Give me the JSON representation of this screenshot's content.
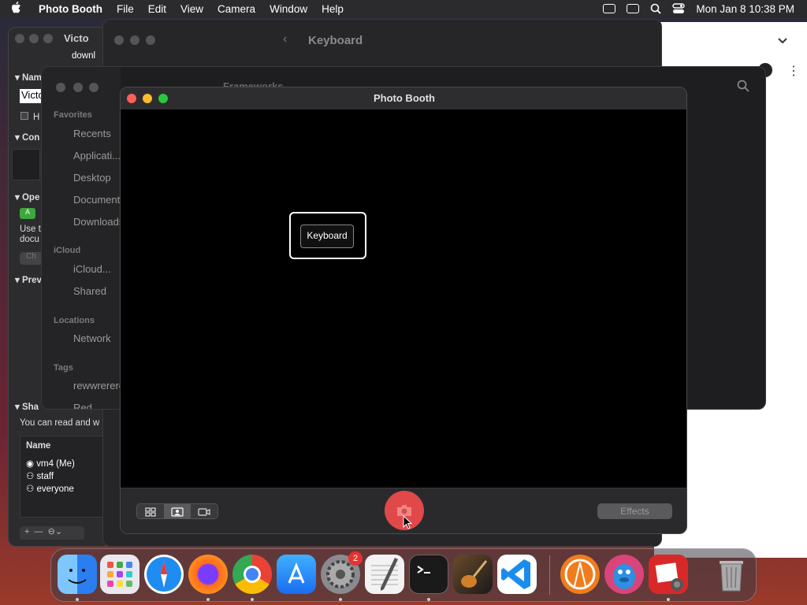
{
  "menubar": {
    "apple_icon": "apple-icon",
    "app_name": "Photo Booth",
    "menus": [
      "File",
      "Edit",
      "View",
      "Camera",
      "Window",
      "Help"
    ],
    "datetime": "Mon Jan 8  10:38 PM"
  },
  "info_window": {
    "title_fragment": "Victo",
    "subtitle_fragment": "downl",
    "name_section": "Nam",
    "name_value": "Victo",
    "hide_label": "H",
    "comments_section": "Con",
    "open_with_section": "Ope",
    "open_with_app": "A",
    "use_text_1": "Use t",
    "use_text_2": "docu",
    "change_button": "Ch",
    "preview_section": "Prev",
    "sharing_section": "Sha",
    "sharing_text": "You can read and w",
    "name_column": "Name",
    "users": [
      {
        "name": "vm4 (Me)",
        "icon": "user-icon"
      },
      {
        "name": "staff",
        "icon": "group-icon"
      },
      {
        "name": "everyone",
        "icon": "group-icon"
      }
    ]
  },
  "system_settings": {
    "title": "Keyboard"
  },
  "finder": {
    "title_fragment": "Frameworks",
    "favorites_header": "Favorites",
    "favorites": [
      "Recents",
      "Applicati...",
      "Desktop",
      "Documents",
      "Downloads"
    ],
    "icloud_header": "iCloud",
    "icloud": [
      "iCloud...",
      "Shared"
    ],
    "locations_header": "Locations",
    "locations": [
      "Network"
    ],
    "tags_header": "Tags",
    "tags": [
      "rewwrerere",
      "Red"
    ]
  },
  "photo_booth": {
    "title": "Photo Booth",
    "overlay_label": "Keyboard",
    "effects_label": "Effects",
    "view_modes": [
      "grid-icon",
      "photo-mode-icon",
      "video-icon"
    ]
  },
  "dock": {
    "apps": [
      {
        "name": "Finder",
        "icon": "finder-icon",
        "color": "#2a7ef0"
      },
      {
        "name": "Launchpad",
        "icon": "launchpad-icon",
        "color": "#e8e8ee"
      },
      {
        "name": "Safari",
        "icon": "safari-icon",
        "color": "#1e8cf0"
      },
      {
        "name": "Firefox",
        "icon": "firefox-icon",
        "color": "#ff6a1f"
      },
      {
        "name": "Chrome",
        "icon": "chrome-icon",
        "color": "#ffffff"
      },
      {
        "name": "App Store",
        "icon": "app-store-icon",
        "color": "#1a8cff"
      },
      {
        "name": "System Settings",
        "icon": "gear-icon",
        "color": "#8a8a90",
        "badge": "2"
      },
      {
        "name": "TextEdit",
        "icon": "textedit-icon",
        "color": "#f2f2f2"
      },
      {
        "name": "Terminal",
        "icon": "terminal-icon",
        "color": "#1a1a1a"
      },
      {
        "name": "Instruments",
        "icon": "guitar-icon",
        "color": "#c46a1a"
      },
      {
        "name": "VS Code",
        "icon": "vscode-icon",
        "color": "#ffffff"
      },
      {
        "name": "Anaconda",
        "icon": "anaconda-icon",
        "color": "#f07c1c"
      },
      {
        "name": "Cyberduck",
        "icon": "cyberduck-icon",
        "color": "#2d90e0"
      },
      {
        "name": "Photo Booth",
        "icon": "photo-booth-icon",
        "color": "#d82828"
      },
      {
        "name": "Trash",
        "icon": "trash-icon",
        "color": "#8a8a8e"
      }
    ]
  }
}
